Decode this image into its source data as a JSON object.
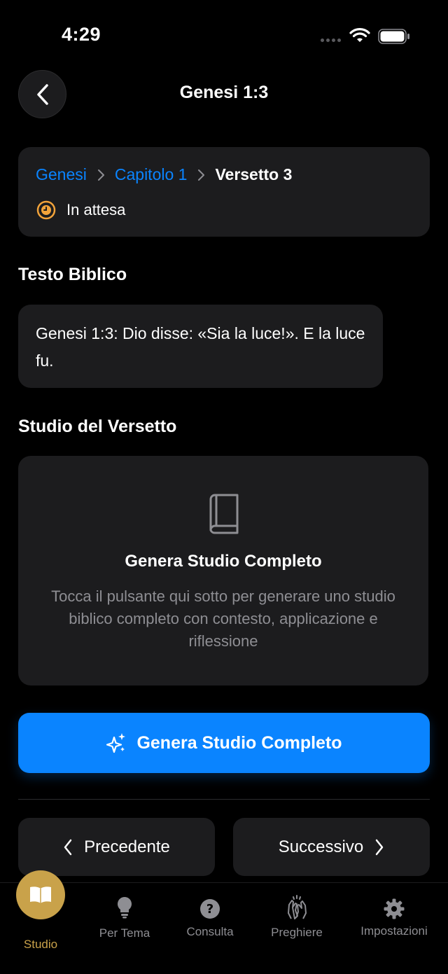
{
  "status_bar": {
    "time": "4:29"
  },
  "nav": {
    "title": "Genesi 1:3"
  },
  "breadcrumb": {
    "book": "Genesi",
    "chapter": "Capitolo 1",
    "verse": "Versetto 3",
    "status": "In attesa"
  },
  "bible_text": {
    "section_title": "Testo Biblico",
    "text": "Genesi 1:3: Dio disse: «Sia la luce!». E la luce fu."
  },
  "study": {
    "section_title": "Studio del Versetto",
    "heading": "Genera Studio Completo",
    "description": "Tocca il pulsante qui sotto per generare uno studio biblico completo con contesto, applicazione e riflessione"
  },
  "actions": {
    "generate_label": "Genera Studio Completo",
    "prev_label": "Precedente",
    "next_label": "Successivo"
  },
  "tabs": {
    "studio": "Studio",
    "per_tema": "Per Tema",
    "consulta": "Consulta",
    "preghiere": "Preghiere",
    "impostazioni": "Impostazioni"
  },
  "colors": {
    "accent": "#0a84ff",
    "active_tab": "#c9a24a",
    "pending": "#f2a33a",
    "card": "#1c1c1e"
  }
}
